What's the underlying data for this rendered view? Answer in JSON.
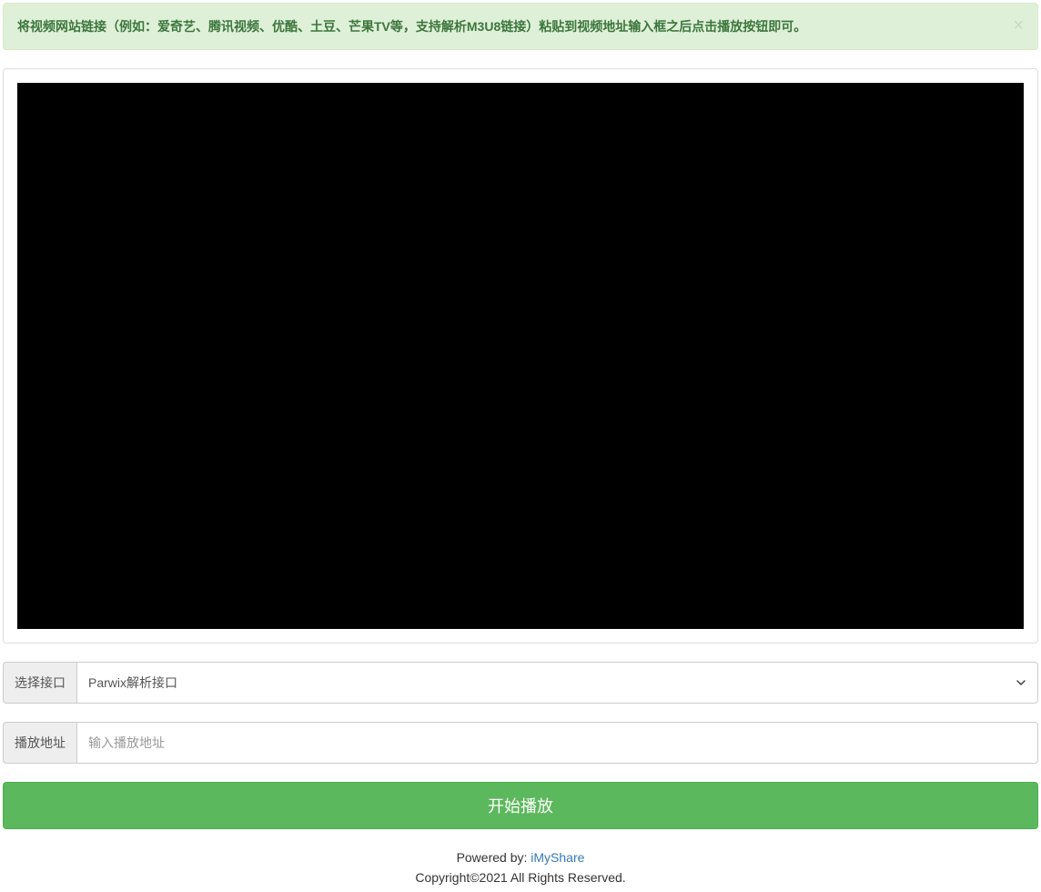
{
  "alert": {
    "message": "将视频网站链接（例如：爱奇艺、腾讯视频、优酷、土豆、芒果TV等，支持解析M3U8链接）粘贴到视频地址输入框之后点击播放按钮即可。",
    "close_label": "×"
  },
  "interface_select": {
    "label": "选择接口",
    "selected": "Parwix解析接口"
  },
  "url_input": {
    "label": "播放地址",
    "placeholder": "输入播放地址",
    "value": ""
  },
  "play_button": {
    "label": "开始播放"
  },
  "footer": {
    "powered_by_text": "Powered by: ",
    "powered_by_link": "iMyShare",
    "copyright": "Copyright©2021 All Rights Reserved."
  }
}
